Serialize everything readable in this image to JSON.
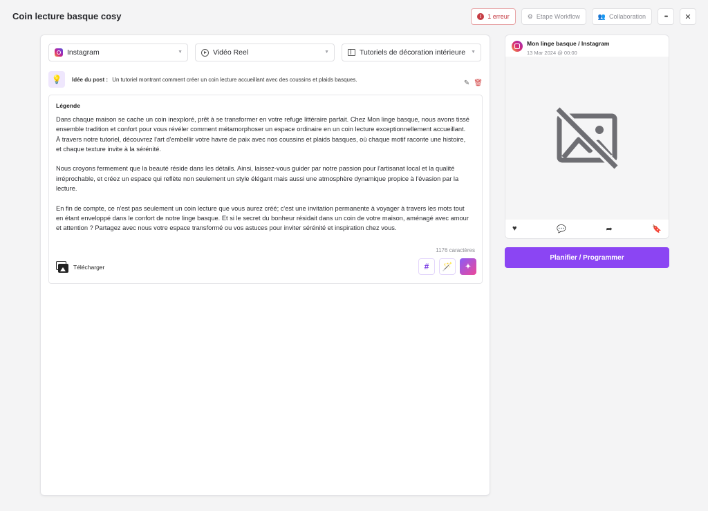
{
  "header": {
    "title": "Coin lecture basque cosy",
    "error_label": "1 erreur",
    "workflow_label": "Etape Workflow",
    "collaboration_label": "Collaboration",
    "more_label": "•••",
    "close_label": "✕"
  },
  "selects": {
    "network": "Instagram",
    "format": "Vidéo Reel",
    "category": "Tutoriels de décoration intérieure"
  },
  "idea": {
    "label": "Idée du post :",
    "text": "Un tutoriel montrant comment créer un coin lecture accueillant avec des coussins et plaids basques."
  },
  "caption": {
    "label": "Légende",
    "paragraphs": [
      "Dans chaque maison se cache un coin inexploré, prêt à se transformer en votre refuge littéraire parfait. Chez Mon linge basque, nous avons tissé ensemble tradition et confort pour vous révéler comment métamorphoser un espace ordinaire en un coin lecture exceptionnellement accueillant. À travers notre tutoriel, découvrez l'art d'embellir votre havre de paix avec nos coussins et plaids basques, où chaque motif raconte une histoire, et chaque texture invite à la sérénité.",
      "Nous croyons fermement que la beauté réside dans les détails. Ainsi, laissez-vous guider par notre passion pour l'artisanat local et la qualité irréprochable, et créez un espace qui reflète non seulement un style élégant mais aussi une atmosphère dynamique propice à l'évasion par la lecture.",
      "En fin de compte, ce n'est pas seulement un coin lecture que vous aurez créé; c'est une invitation permanente à voyager à travers les mots tout en étant enveloppé dans le confort de notre linge basque. Et si le secret du bonheur résidait dans un coin de votre maison, aménagé avec amour et attention ? Partagez avec nous votre espace transformé ou vos astuces pour inviter sérénité et inspiration chez vous."
    ],
    "char_count": "1176 caractères",
    "upload_label": "Télécharger"
  },
  "preview": {
    "account": "Mon linge basque / Instagram",
    "date": "13 Mar 2024 @ 00:00"
  },
  "schedule_label": "Planifier / Programmer",
  "colors": {
    "accent": "#8b45f3",
    "error": "#c53b43"
  }
}
